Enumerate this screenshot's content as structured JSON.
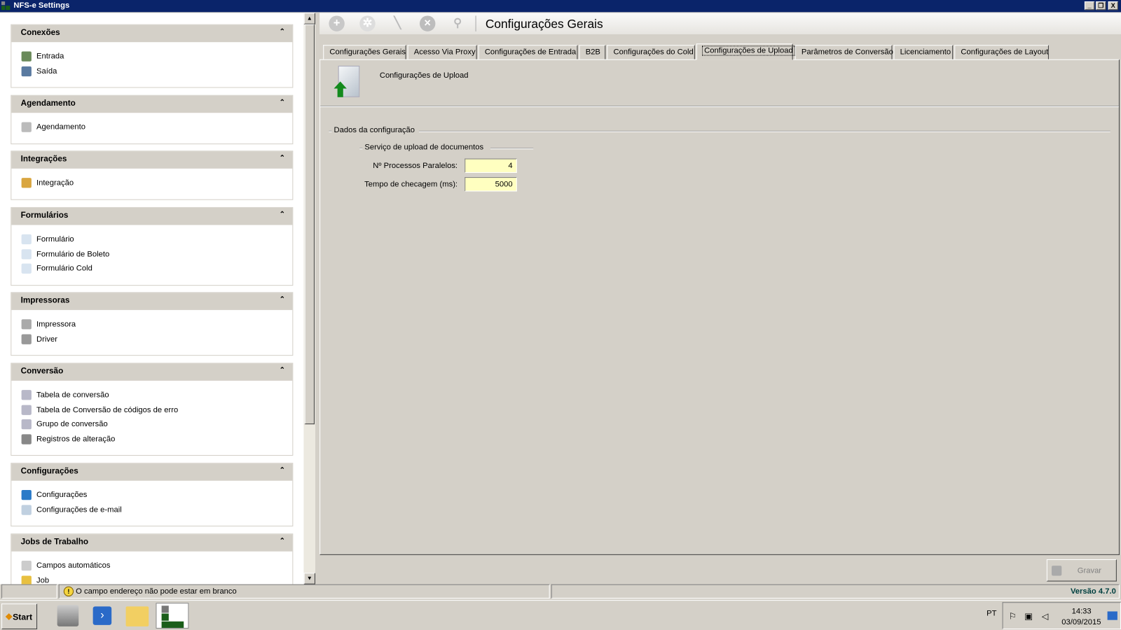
{
  "window": {
    "title": "NFS-e Settings",
    "controls": [
      "minimize",
      "restore",
      "close"
    ]
  },
  "sidebar": {
    "groups": [
      {
        "title": "Conexões",
        "items": [
          {
            "label": "Entrada",
            "icon": "connection-in-icon"
          },
          {
            "label": "Saída",
            "icon": "connection-out-icon"
          }
        ]
      },
      {
        "title": "Agendamento",
        "items": [
          {
            "label": "Agendamento",
            "icon": "calendar-icon"
          }
        ]
      },
      {
        "title": "Integrações",
        "items": [
          {
            "label": "Integração",
            "icon": "integration-icon"
          }
        ]
      },
      {
        "title": "Formulários",
        "items": [
          {
            "label": "Formulário",
            "icon": "document-icon"
          },
          {
            "label": "Formulário de Boleto",
            "icon": "document-icon"
          },
          {
            "label": "Formulário Cold",
            "icon": "document-icon"
          }
        ]
      },
      {
        "title": "Impressoras",
        "items": [
          {
            "label": "Impressora",
            "icon": "printer-icon"
          },
          {
            "label": "Driver",
            "icon": "driver-icon"
          }
        ]
      },
      {
        "title": "Conversão",
        "items": [
          {
            "label": "Tabela de conversão",
            "icon": "table-icon"
          },
          {
            "label": "Tabela de Conversão de códigos de erro",
            "icon": "table-icon"
          },
          {
            "label": "Grupo de conversão",
            "icon": "table-icon"
          },
          {
            "label": "Registros de alteração",
            "icon": "globe-icon"
          }
        ]
      },
      {
        "title": "Configurações",
        "items": [
          {
            "label": "Configurações",
            "icon": "gear-icon"
          },
          {
            "label": "Configurações de e-mail",
            "icon": "mail-icon"
          }
        ]
      },
      {
        "title": "Jobs de Trabalho",
        "items": [
          {
            "label": "Campos automáticos",
            "icon": "wand-icon"
          },
          {
            "label": "Job",
            "icon": "user-icon"
          }
        ]
      }
    ]
  },
  "toolbar": {
    "title": "Configurações Gerais",
    "buttons": [
      "add",
      "settings",
      "edit",
      "delete",
      "search"
    ]
  },
  "tabs": [
    {
      "label": "Configurações Gerais"
    },
    {
      "label": "Acesso Via Proxy"
    },
    {
      "label": "Configurações de Entrada"
    },
    {
      "label": "B2B"
    },
    {
      "label": "Configurações do Cold"
    },
    {
      "label": "Configurações de Upload",
      "active": true
    },
    {
      "label": "Parâmetros de Conversão"
    },
    {
      "label": "Licenciamento"
    },
    {
      "label": "Configurações de Layout"
    }
  ],
  "content": {
    "header": "Configurações de Upload",
    "group": "Dados da configuração",
    "subgroup": "Serviço de upload de documentos",
    "fields": [
      {
        "label": "Nº Processos Paralelos:",
        "value": "4"
      },
      {
        "label": "Tempo de checagem (ms):",
        "value": "5000"
      }
    ],
    "save_label": "Gravar"
  },
  "status": {
    "message": "O campo endereço não pode estar em branco",
    "version": "Versão 4.7.0"
  },
  "taskbar": {
    "start": "Start",
    "lang": "PT",
    "time": "14:33",
    "date": "03/09/2015"
  },
  "colors": {
    "titlebar": "#0a246a",
    "input_bg": "#ffffc0",
    "version": "#004040"
  }
}
